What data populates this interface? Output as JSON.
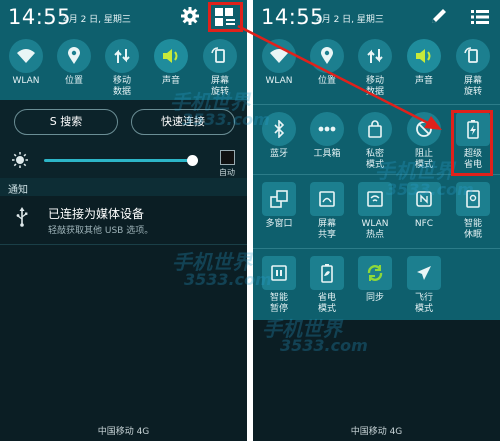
{
  "left": {
    "time": "14:55",
    "date": "4月 2 日, 星期三",
    "toggles": [
      {
        "label": "WLAN",
        "label2": "",
        "icon": "wifi-icon"
      },
      {
        "label": "位置",
        "label2": "",
        "icon": "location-icon"
      },
      {
        "label": "移动",
        "label2": "数据",
        "icon": "mobile-data-icon"
      },
      {
        "label": "声音",
        "label2": "",
        "icon": "sound-icon"
      },
      {
        "label": "屏幕",
        "label2": "旋转",
        "icon": "rotate-icon"
      }
    ],
    "search_button": "S 搜索",
    "quick_connect_button": "快速连接",
    "auto_label": "自动",
    "notifications_header": "通知",
    "notification": {
      "title": "已连接为媒体设备",
      "subtitle": "轻敲获取其他 USB 选项。",
      "icon": "usb-icon"
    },
    "carrier": "中国移动 4G"
  },
  "right": {
    "time": "14:55",
    "date": "4月 2 日, 星期三",
    "row1": [
      {
        "label": "WLAN",
        "label2": "",
        "icon": "wifi-icon"
      },
      {
        "label": "位置",
        "label2": "",
        "icon": "location-icon"
      },
      {
        "label": "移动",
        "label2": "数据",
        "icon": "mobile-data-icon"
      },
      {
        "label": "声音",
        "label2": "",
        "icon": "sound-icon"
      },
      {
        "label": "屏幕",
        "label2": "旋转",
        "icon": "rotate-icon"
      }
    ],
    "row2": [
      {
        "label": "蓝牙",
        "label2": "",
        "icon": "bluetooth-icon"
      },
      {
        "label": "工具箱",
        "label2": "",
        "icon": "toolbox-icon"
      },
      {
        "label": "私密",
        "label2": "模式",
        "icon": "private-mode-icon"
      },
      {
        "label": "阻止",
        "label2": "模式",
        "icon": "block-mode-icon"
      },
      {
        "label": "超级",
        "label2": "省电",
        "icon": "ultra-power-saving-icon"
      }
    ],
    "row3": [
      {
        "label": "多窗口",
        "label2": "",
        "icon": "multi-window-icon"
      },
      {
        "label": "屏幕",
        "label2": "共享",
        "icon": "screen-share-icon"
      },
      {
        "label": "WLAN",
        "label2": "热点",
        "icon": "hotspot-icon"
      },
      {
        "label": "NFC",
        "label2": "",
        "icon": "nfc-icon"
      },
      {
        "label": "智能",
        "label2": "休眠",
        "icon": "smart-stay-icon"
      }
    ],
    "row4": [
      {
        "label": "智能",
        "label2": "暂停",
        "icon": "smart-pause-icon"
      },
      {
        "label": "省电",
        "label2": "模式",
        "icon": "power-saving-icon"
      },
      {
        "label": "同步",
        "label2": "",
        "icon": "sync-icon"
      },
      {
        "label": "飞行",
        "label2": "模式",
        "icon": "airplane-icon"
      }
    ],
    "carrier": "中国移动 4G"
  },
  "watermark": {
    "text1": "手机世界",
    "text2": "3533.com"
  },
  "colors": {
    "status_bar": "#0e5f6d",
    "background": "#0b1e24",
    "accent": "#2db6c8",
    "sound_on": "#c8ea3a",
    "sync_on": "#8ed83a",
    "highlight": "#e0211b"
  }
}
